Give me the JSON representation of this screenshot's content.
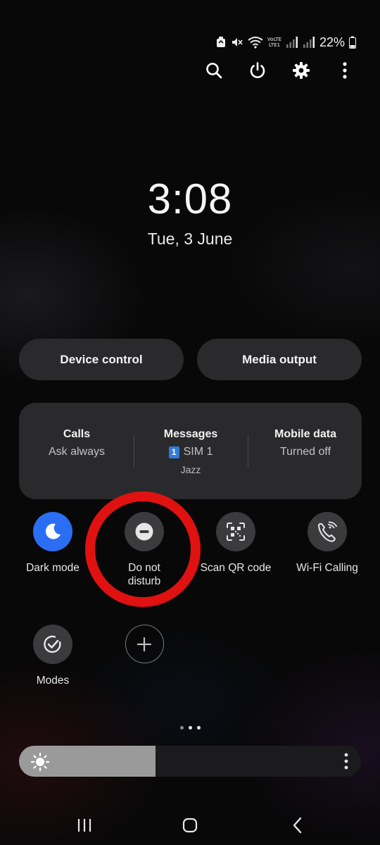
{
  "status_bar": {
    "battery": "22%"
  },
  "clock": {
    "time": "3:08",
    "date": "Tue, 3 June"
  },
  "controls": {
    "device_control": "Device control",
    "media_output": "Media output"
  },
  "info_card": {
    "calls": {
      "title": "Calls",
      "status": "Ask always"
    },
    "messages": {
      "title": "Messages",
      "sim_number": "1",
      "sim_label": "SIM 1",
      "carrier": "Jazz"
    },
    "mobile_data": {
      "title": "Mobile data",
      "status": "Turned off"
    }
  },
  "tiles": [
    {
      "label": "Dark mode",
      "icon": "moon-icon",
      "active": true
    },
    {
      "label": "Do not\ndisturb",
      "icon": "do-not-disturb-icon",
      "active": false
    },
    {
      "label": "Scan QR code",
      "icon": "qr-scan-icon",
      "active": false
    },
    {
      "label": "Wi-Fi Calling",
      "icon": "wifi-calling-icon",
      "active": false
    },
    {
      "label": "Modes",
      "icon": "modes-icon",
      "active": false
    },
    {
      "label": "",
      "icon": "add-icon",
      "active": false
    }
  ],
  "page_indicator": {
    "current": 2,
    "total": 3
  },
  "brightness": {
    "level": 0.4
  },
  "colors": {
    "accent": "#2a6ef4",
    "highlight_circle": "#e01111",
    "panel": "#2a2a2c"
  }
}
